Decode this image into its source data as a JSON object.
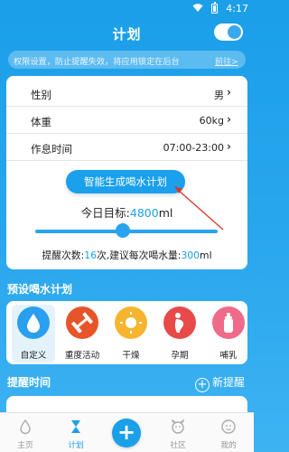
{
  "status_bar": {
    "time": "4:17"
  },
  "header": {
    "title": "计划",
    "toggle_on": true
  },
  "notice": {
    "text": "权限设置，防止提醒失效，将应用锁定在后台",
    "link": "前往>"
  },
  "settings": {
    "gender": {
      "label": "性别",
      "value": "男",
      "chevron": "›"
    },
    "weight": {
      "label": "体重",
      "value": "60kg",
      "chevron": "›"
    },
    "schedule": {
      "label": "作息时间",
      "value": "07:00-23:00",
      "chevron": "›"
    }
  },
  "generate_button": "智能生成喝水计划",
  "target": {
    "prefix": "今日目标:",
    "amount": "4800",
    "unit": "ml",
    "slider_fraction": 0.48
  },
  "reminder": {
    "prefix": "提醒次数:",
    "count": "16",
    "middle": "次,建议每次喝水量:",
    "amount": "300",
    "unit": "ml"
  },
  "preset_section": {
    "title": "预设喝水计划"
  },
  "presets": [
    {
      "label": "自定义",
      "icon": "water-drop-icon",
      "color": "#2a9ff0",
      "selected": true
    },
    {
      "label": "重度活动",
      "icon": "dumbbell-icon",
      "color": "#e8542a",
      "selected": false
    },
    {
      "label": "干燥",
      "icon": "sun-icon",
      "color": "#f5b52e",
      "selected": false
    },
    {
      "label": "孕期",
      "icon": "pregnancy-icon",
      "color": "#e84a4a",
      "selected": false
    },
    {
      "label": "哺乳",
      "icon": "baby-bottle-icon",
      "color": "#f06a8a",
      "selected": false
    }
  ],
  "reminder_section": {
    "title": "提醒时间",
    "new_label": "新提醒"
  },
  "bottom_nav": [
    {
      "label": "主页",
      "icon": "home-drop-icon",
      "active": false
    },
    {
      "label": "计划",
      "icon": "hourglass-icon",
      "active": true
    },
    {
      "label": "社区",
      "icon": "community-icon",
      "active": false
    },
    {
      "label": "我的",
      "icon": "profile-icon",
      "active": false
    }
  ]
}
